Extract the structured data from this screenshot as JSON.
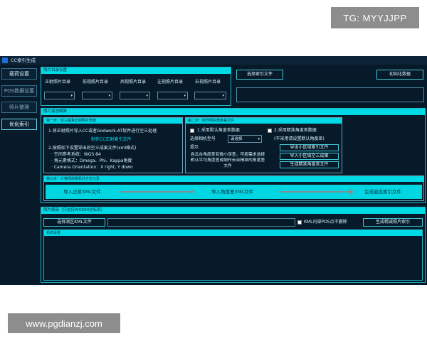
{
  "watermark_top": "TG: MYYJJPP",
  "watermark_bottom": "www.pgdianzj.com",
  "window": {
    "title": "CC索引生成"
  },
  "sidebar": {
    "items": [
      {
        "label": "载荷设置"
      },
      {
        "label": "POS数据设置"
      },
      {
        "label": "照片整理"
      },
      {
        "label": "优化索引"
      }
    ]
  },
  "photo_dirs": {
    "header": "照片目录设置",
    "labels": [
      "正射照片目录",
      "前视照片目录",
      "后视照片目录",
      "左视照片目录",
      "右视照片目录"
    ],
    "select_index_button": "选择索引文件",
    "init_data_button": "初始化数据"
  },
  "optimize": {
    "header": "照片姿态解算",
    "step1": {
      "header": "第一步：空三解算正射照片角度",
      "line1": "1.将正射照片导入CC或者Godwork-AT软件进行空三处理",
      "make_button": "制作CC正射索引文件",
      "line2": "2.按照如下设置导出的空三成果文件(xml格式)",
      "line3": "· 空间参考系统：WGS 84",
      "line4": "· 角元素格式：Omega、Phi、Kappa角度",
      "line5": "· Camera Orientation：X right, Y down"
    },
    "step2": {
      "header": "第二步：制作倾斜角度差文件",
      "opt1": "1.采用默认角度差数据",
      "select_camera_label": "选择相机型号",
      "select_camera_value": "请选择",
      "hint_label": "提示",
      "hint_text": "各云台角度差有微小误差，可按需求选择默认平均角度差或制作云台精准的角度差文件",
      "opt2": "2.采用精准角度差数据",
      "opt2_note": "(不采用请设置默认角度差)",
      "export_button": "导出小区域索引文件",
      "import_button": "导入小区域空三成果",
      "generate_button": "生成精准角度差文件"
    },
    "step3": {
      "header": "第三步：计算倾斜相机外方位元素",
      "import_xml": "导入正射XML文件",
      "import_angle": "导入角度差XML文件",
      "generate": "生成姿态索引文件"
    }
  },
  "photo_fine": {
    "header": "照片精简（只支持WGS84坐标系）",
    "select_kml_button": "选择测区KML文件",
    "kml_pos_checkbox": "KML内部POS点不删除",
    "generate_button": "生成精减照片索引",
    "log_label": "机高设置"
  }
}
